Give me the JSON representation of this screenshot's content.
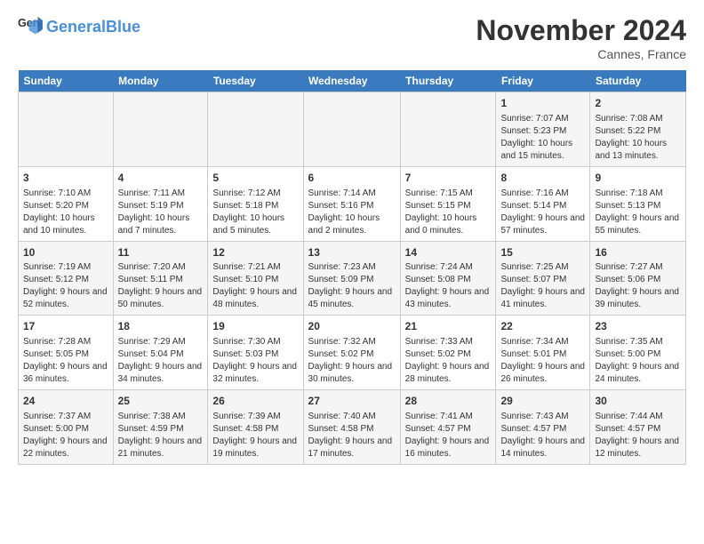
{
  "logo": {
    "text_general": "General",
    "text_blue": "Blue"
  },
  "header": {
    "month_title": "November 2024",
    "location": "Cannes, France"
  },
  "days_of_week": [
    "Sunday",
    "Monday",
    "Tuesday",
    "Wednesday",
    "Thursday",
    "Friday",
    "Saturday"
  ],
  "weeks": [
    [
      {
        "day": "",
        "info": ""
      },
      {
        "day": "",
        "info": ""
      },
      {
        "day": "",
        "info": ""
      },
      {
        "day": "",
        "info": ""
      },
      {
        "day": "",
        "info": ""
      },
      {
        "day": "1",
        "info": "Sunrise: 7:07 AM\nSunset: 5:23 PM\nDaylight: 10 hours and 15 minutes."
      },
      {
        "day": "2",
        "info": "Sunrise: 7:08 AM\nSunset: 5:22 PM\nDaylight: 10 hours and 13 minutes."
      }
    ],
    [
      {
        "day": "3",
        "info": "Sunrise: 7:10 AM\nSunset: 5:20 PM\nDaylight: 10 hours and 10 minutes."
      },
      {
        "day": "4",
        "info": "Sunrise: 7:11 AM\nSunset: 5:19 PM\nDaylight: 10 hours and 7 minutes."
      },
      {
        "day": "5",
        "info": "Sunrise: 7:12 AM\nSunset: 5:18 PM\nDaylight: 10 hours and 5 minutes."
      },
      {
        "day": "6",
        "info": "Sunrise: 7:14 AM\nSunset: 5:16 PM\nDaylight: 10 hours and 2 minutes."
      },
      {
        "day": "7",
        "info": "Sunrise: 7:15 AM\nSunset: 5:15 PM\nDaylight: 10 hours and 0 minutes."
      },
      {
        "day": "8",
        "info": "Sunrise: 7:16 AM\nSunset: 5:14 PM\nDaylight: 9 hours and 57 minutes."
      },
      {
        "day": "9",
        "info": "Sunrise: 7:18 AM\nSunset: 5:13 PM\nDaylight: 9 hours and 55 minutes."
      }
    ],
    [
      {
        "day": "10",
        "info": "Sunrise: 7:19 AM\nSunset: 5:12 PM\nDaylight: 9 hours and 52 minutes."
      },
      {
        "day": "11",
        "info": "Sunrise: 7:20 AM\nSunset: 5:11 PM\nDaylight: 9 hours and 50 minutes."
      },
      {
        "day": "12",
        "info": "Sunrise: 7:21 AM\nSunset: 5:10 PM\nDaylight: 9 hours and 48 minutes."
      },
      {
        "day": "13",
        "info": "Sunrise: 7:23 AM\nSunset: 5:09 PM\nDaylight: 9 hours and 45 minutes."
      },
      {
        "day": "14",
        "info": "Sunrise: 7:24 AM\nSunset: 5:08 PM\nDaylight: 9 hours and 43 minutes."
      },
      {
        "day": "15",
        "info": "Sunrise: 7:25 AM\nSunset: 5:07 PM\nDaylight: 9 hours and 41 minutes."
      },
      {
        "day": "16",
        "info": "Sunrise: 7:27 AM\nSunset: 5:06 PM\nDaylight: 9 hours and 39 minutes."
      }
    ],
    [
      {
        "day": "17",
        "info": "Sunrise: 7:28 AM\nSunset: 5:05 PM\nDaylight: 9 hours and 36 minutes."
      },
      {
        "day": "18",
        "info": "Sunrise: 7:29 AM\nSunset: 5:04 PM\nDaylight: 9 hours and 34 minutes."
      },
      {
        "day": "19",
        "info": "Sunrise: 7:30 AM\nSunset: 5:03 PM\nDaylight: 9 hours and 32 minutes."
      },
      {
        "day": "20",
        "info": "Sunrise: 7:32 AM\nSunset: 5:02 PM\nDaylight: 9 hours and 30 minutes."
      },
      {
        "day": "21",
        "info": "Sunrise: 7:33 AM\nSunset: 5:02 PM\nDaylight: 9 hours and 28 minutes."
      },
      {
        "day": "22",
        "info": "Sunrise: 7:34 AM\nSunset: 5:01 PM\nDaylight: 9 hours and 26 minutes."
      },
      {
        "day": "23",
        "info": "Sunrise: 7:35 AM\nSunset: 5:00 PM\nDaylight: 9 hours and 24 minutes."
      }
    ],
    [
      {
        "day": "24",
        "info": "Sunrise: 7:37 AM\nSunset: 5:00 PM\nDaylight: 9 hours and 22 minutes."
      },
      {
        "day": "25",
        "info": "Sunrise: 7:38 AM\nSunset: 4:59 PM\nDaylight: 9 hours and 21 minutes."
      },
      {
        "day": "26",
        "info": "Sunrise: 7:39 AM\nSunset: 4:58 PM\nDaylight: 9 hours and 19 minutes."
      },
      {
        "day": "27",
        "info": "Sunrise: 7:40 AM\nSunset: 4:58 PM\nDaylight: 9 hours and 17 minutes."
      },
      {
        "day": "28",
        "info": "Sunrise: 7:41 AM\nSunset: 4:57 PM\nDaylight: 9 hours and 16 minutes."
      },
      {
        "day": "29",
        "info": "Sunrise: 7:43 AM\nSunset: 4:57 PM\nDaylight: 9 hours and 14 minutes."
      },
      {
        "day": "30",
        "info": "Sunrise: 7:44 AM\nSunset: 4:57 PM\nDaylight: 9 hours and 12 minutes."
      }
    ]
  ]
}
